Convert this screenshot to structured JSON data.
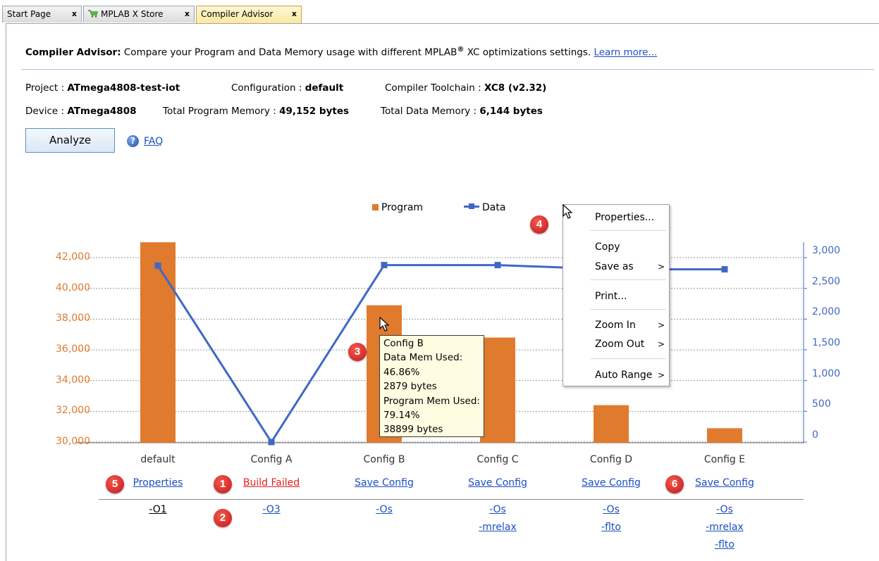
{
  "tabs": [
    {
      "label": "Start Page",
      "close": "x"
    },
    {
      "label": "MPLAB X Store",
      "close": "x"
    },
    {
      "label": "Compiler Advisor",
      "close": "x"
    }
  ],
  "header": {
    "title": "Compiler Advisor:",
    "text": " Compare your Program and Data Memory usage with different MPLAB",
    "registered": "®",
    "text2": " XC optimizations settings. ",
    "learn_more": "Learn more..."
  },
  "info": {
    "project_label": "Project : ",
    "project": "ATmega4808-test-iot",
    "configuration_label": "Configuration : ",
    "configuration": "default",
    "toolchain_label": "Compiler Toolchain : ",
    "toolchain": "XC8 (v2.32)",
    "device_label": "Device : ",
    "device": "ATmega4808",
    "program_mem_label": "Total Program Memory : ",
    "program_mem": "49,152 bytes",
    "data_mem_label": "Total Data Memory : ",
    "data_mem": "6,144 bytes"
  },
  "analyze_label": "Analyze",
  "faq_icon": "question-icon",
  "faq_label": "FAQ",
  "chart_data": {
    "type": "bar",
    "legend_position": "top-center",
    "grid": true,
    "categories": [
      "default",
      "Config A",
      "Config B",
      "Config C",
      "Config D",
      "Config E"
    ],
    "series": [
      {
        "name": "Program",
        "type": "bar",
        "axis": "left",
        "color": "#e07b2e",
        "values": [
          43000,
          29500,
          38899,
          36800,
          32400,
          30900
        ]
      },
      {
        "name": "Data",
        "type": "line",
        "axis": "right",
        "color": "#3f68c4",
        "values": [
          2870,
          0,
          2879,
          2879,
          2810,
          2810
        ]
      }
    ],
    "y_left": {
      "ticks": [
        "30,000",
        "32,000",
        "34,000",
        "36,000",
        "38,000",
        "40,000",
        "42,000"
      ],
      "ylim": [
        30000,
        42000
      ]
    },
    "y_right": {
      "ticks": [
        "0",
        "500",
        "1,000",
        "1,500",
        "2,000",
        "2,500",
        "3,000"
      ],
      "ylim": [
        0,
        3000
      ]
    }
  },
  "configs": [
    {
      "action": "Properties",
      "failed": false,
      "flags": [
        "-O1"
      ]
    },
    {
      "action": "Build Failed",
      "failed": true,
      "flags": [
        "-O3"
      ]
    },
    {
      "action": "Save Config",
      "failed": false,
      "flags": [
        "-Os"
      ]
    },
    {
      "action": "Save Config",
      "failed": false,
      "flags": [
        "-Os",
        "-mrelax"
      ]
    },
    {
      "action": "Save Config",
      "failed": false,
      "flags": [
        "-Os",
        "-flto"
      ]
    },
    {
      "action": "Save Config",
      "failed": false,
      "flags": [
        "-Os",
        "-mrelax",
        "-flto"
      ]
    }
  ],
  "tooltip": {
    "lines": [
      "Config B",
      "Data Mem Used:",
      "46.86%",
      "2879 bytes",
      "Program Mem Used:",
      "79.14%",
      "38899 bytes"
    ]
  },
  "context_menu": {
    "items": [
      {
        "label": "Properties...",
        "submenu": false
      },
      {
        "label": "Copy",
        "submenu": false
      },
      {
        "label": "Save as",
        "submenu": true
      },
      {
        "label": "Print...",
        "submenu": false
      },
      {
        "label": "Zoom In",
        "submenu": true
      },
      {
        "label": "Zoom Out",
        "submenu": true
      },
      {
        "label": "Auto Range",
        "submenu": true
      }
    ],
    "submenu_arrow": ">"
  },
  "badges": [
    "1",
    "2",
    "3",
    "4",
    "5",
    "6"
  ]
}
